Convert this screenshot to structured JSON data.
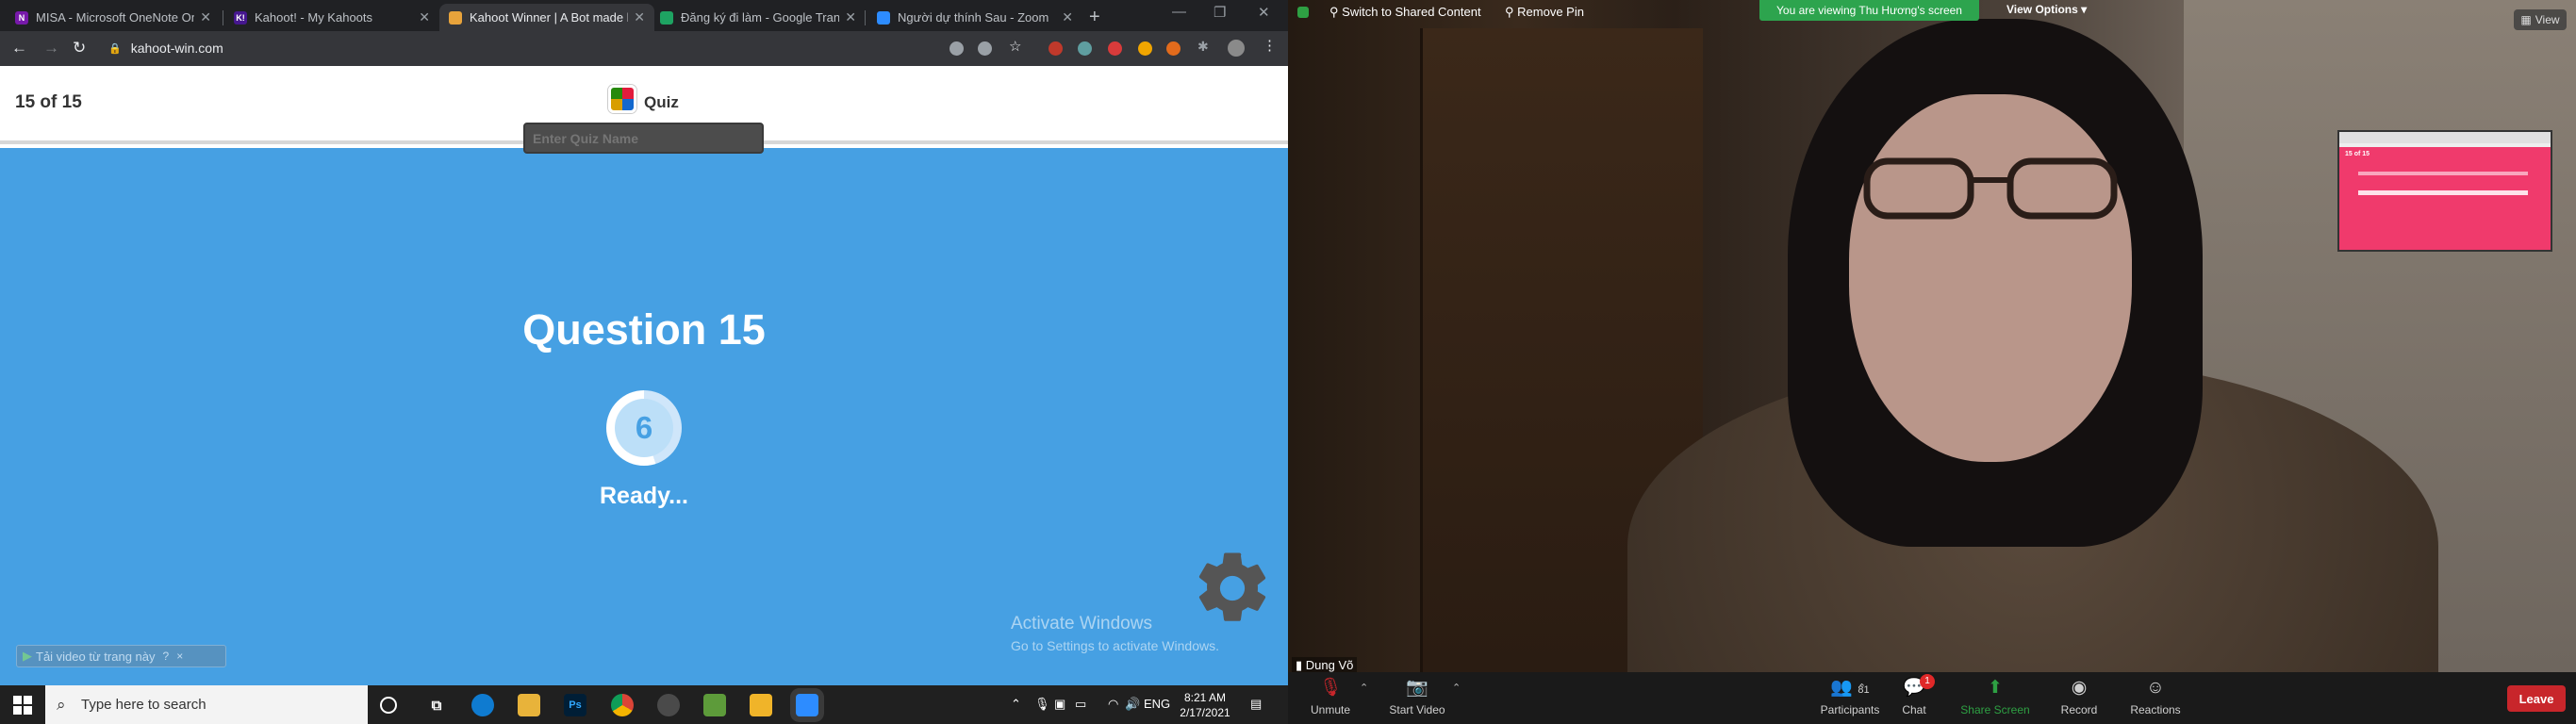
{
  "browser": {
    "tabs": [
      {
        "label": "MISA - Microsoft OneNote On",
        "fav": "N",
        "fav_color": "#7719aa"
      },
      {
        "label": "Kahoot! - My Kahoots",
        "fav": "K!",
        "fav_color": "#46178f"
      },
      {
        "label": "Kahoot Winner | A Bot made b",
        "fav": "",
        "fav_color": "#e8a33b"
      },
      {
        "label": "Đăng ký đi làm - Google Trang",
        "fav": "",
        "fav_color": "#1ea362"
      },
      {
        "label": "Người dự thính Sau - Zoom",
        "fav": "",
        "fav_color": "#2d8cff"
      }
    ],
    "active_tab": 2,
    "url": "kahoot-win.com"
  },
  "page": {
    "counter": "15 of 15",
    "quiz_label": "Quiz",
    "quiz_placeholder": "Enter Quiz Name",
    "question_title": "Question 15",
    "timer_value": "6",
    "ready_text": "Ready...",
    "activate_title": "Activate Windows",
    "activate_sub": "Go to Settings to activate Windows.",
    "download_bar": "Tải video từ trang này",
    "download_q": "?",
    "download_x": "×"
  },
  "taskbar": {
    "search_placeholder": "Type here to search",
    "lang": "ENG",
    "time": "8:21 AM",
    "date": "2/17/2021"
  },
  "zoom": {
    "switch_label": "Switch to Shared Content",
    "remove_pin_label": "Remove Pin",
    "viewing_banner": "You are viewing Thu Hương's screen",
    "view_options": "View Options",
    "view_button": "View",
    "thumb_counter": "15 of 15",
    "speaker_name": "Dung Võ",
    "participants_count": "81",
    "chat_badge": "1",
    "buttons": {
      "unmute": "Unmute",
      "start_video": "Start Video",
      "participants": "Participants",
      "chat": "Chat",
      "share": "Share Screen",
      "record": "Record",
      "reactions": "Reactions",
      "leave": "Leave"
    }
  },
  "colors": {
    "kahoot_blue": "#46a0e3",
    "zoom_green": "#2da44e",
    "leave_red": "#c8262b"
  }
}
